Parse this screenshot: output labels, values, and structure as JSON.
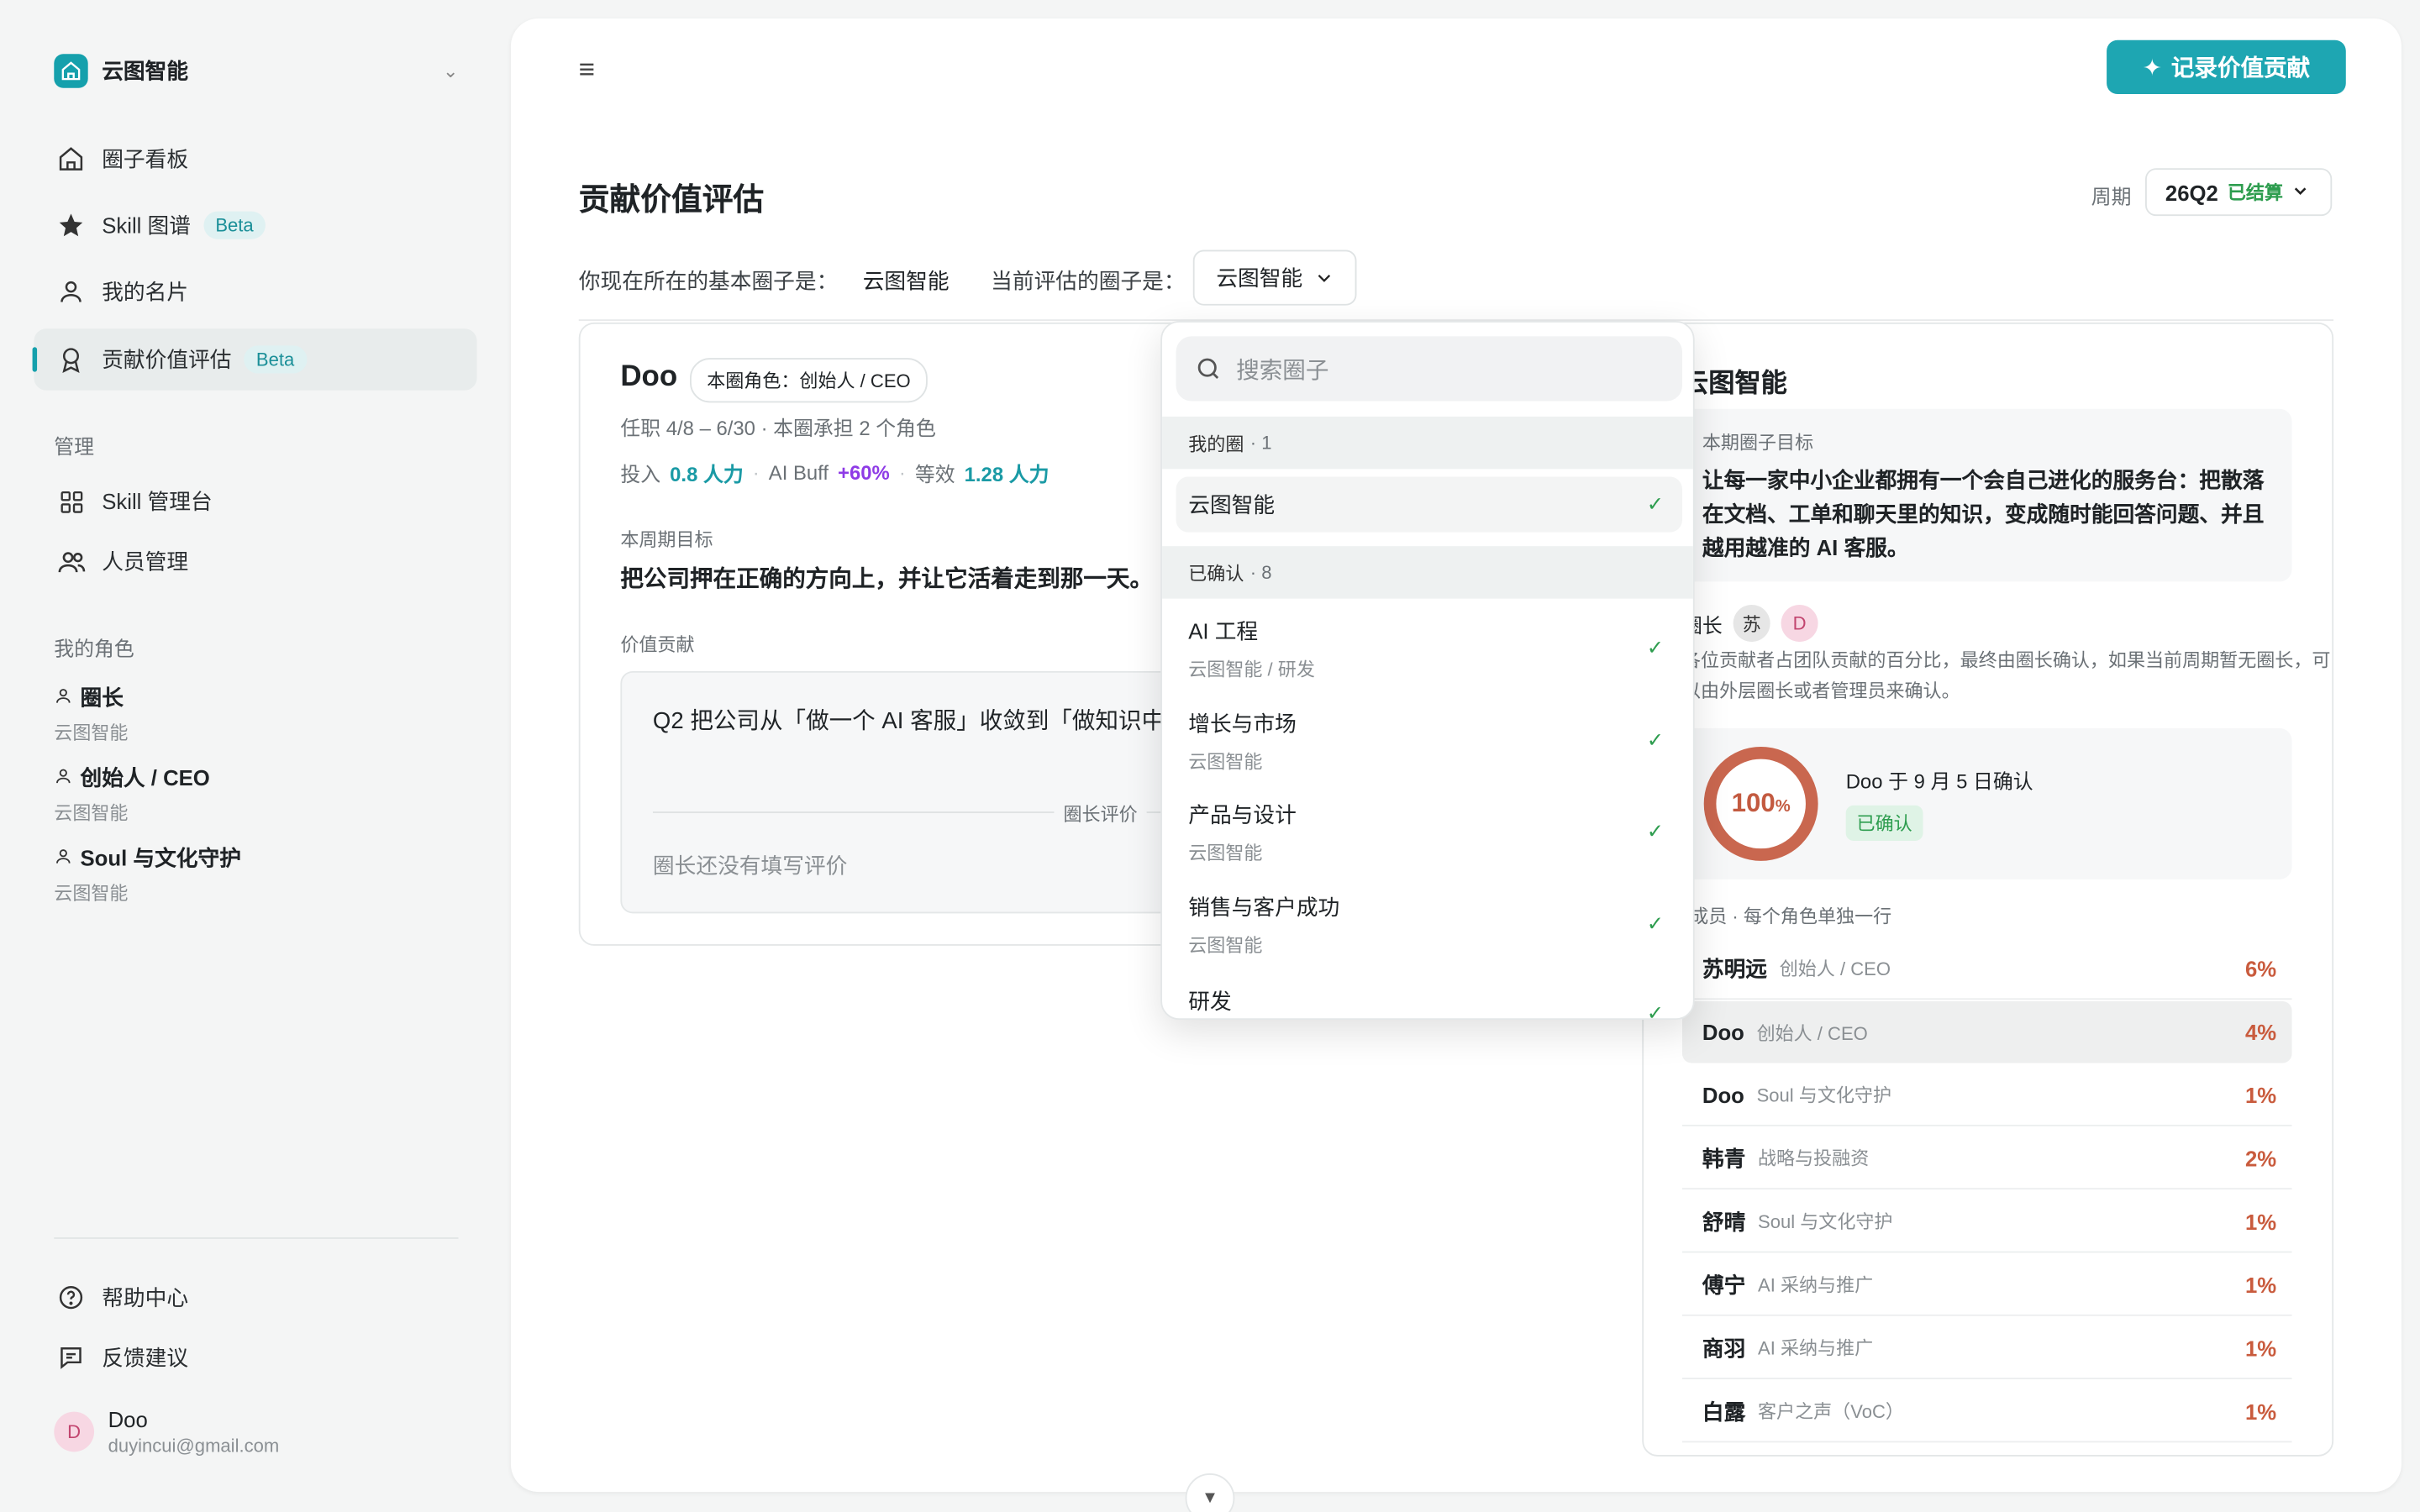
{
  "sidebar": {
    "workspace": "云图智能",
    "nav": [
      {
        "label": "圈子看板"
      },
      {
        "label": "Skill 图谱",
        "badge": "Beta"
      },
      {
        "label": "我的名片"
      },
      {
        "label": "贡献价值评估",
        "badge": "Beta"
      }
    ],
    "manage_label": "管理",
    "manage": [
      {
        "label": "Skill 管理台"
      },
      {
        "label": "人员管理"
      }
    ],
    "roles_label": "我的角色",
    "roles": [
      {
        "name": "圈长",
        "sub": "云图智能"
      },
      {
        "name": "创始人 / CEO",
        "sub": "云图智能"
      },
      {
        "name": "Soul 与文化守护",
        "sub": "云图智能"
      }
    ],
    "help": "帮助中心",
    "feedback": "反馈建议",
    "user": {
      "initial": "D",
      "name": "Doo",
      "email": "duyincui@gmail.com"
    }
  },
  "header": {
    "record_button": "记录价值贡献",
    "title": "贡献价值评估",
    "period_label": "周期",
    "period_value": "26Q2",
    "period_status": "已结算",
    "base_circle_label": "你现在所在的基本圈子是：",
    "base_circle_value": "云图智能",
    "current_circle_label": "当前评估的圈子是：",
    "current_circle_value": "云图智能"
  },
  "left": {
    "name": "Doo",
    "role_badge": "本圈角色：创始人 / CEO",
    "tenure": "任职 4/8 – 6/30 · 本圈承担 2 个角色",
    "input_label": "投入",
    "input_value": "0.8 人力",
    "buff_label": "AI Buff",
    "buff_value": "+60%",
    "eq_label": "等效",
    "eq_value": "1.28 人力",
    "goal_label": "本周期目标",
    "goal": "把公司押在正确的方向上，并让它活着走到那一天。",
    "value_label": "价值贡献",
    "value_text": "Q2 把公司从「做一个 AI 客服」收敛到「做知识中台」，团队和融资都顺了。",
    "review_label": "圈长评价",
    "review_empty": "圈长还没有填写评价"
  },
  "right": {
    "title": "云图智能",
    "goal_label": "本期圈子目标",
    "goal": "让每一家中小企业都拥有一个会自己进化的服务台：把散落在文档、工单和聊天里的知识，变成随时能回答问题、并且越用越准的 AI 客服。",
    "lead_label": "圈长",
    "lead_avatars": [
      "苏",
      "D"
    ],
    "desc": "各位贡献者占团队贡献的百分比，最终由圈长确认，如果当前周期暂无圈长，可以由外层圈长或者管理员来确认。",
    "percent": "100",
    "percent_unit": "%",
    "confirm_text": "Doo 于 9 月 5 日确认",
    "confirm_badge": "已确认",
    "members_label": "成员 · 每个角色单独一行",
    "members": [
      {
        "name": "苏明远",
        "role": "创始人 / CEO",
        "pct": "6%"
      },
      {
        "name": "Doo",
        "role": "创始人 / CEO",
        "pct": "4%"
      },
      {
        "name": "Doo",
        "role": "Soul 与文化守护",
        "pct": "1%"
      },
      {
        "name": "韩青",
        "role": "战略与投融资",
        "pct": "2%"
      },
      {
        "name": "舒晴",
        "role": "Soul 与文化守护",
        "pct": "1%"
      },
      {
        "name": "傅宁",
        "role": "AI 采纳与推广",
        "pct": "1%"
      },
      {
        "name": "商羽",
        "role": "AI 采纳与推广",
        "pct": "1%"
      },
      {
        "name": "白露",
        "role": "客户之声（VoC）",
        "pct": "1%"
      }
    ]
  },
  "dropdown": {
    "search_placeholder": "搜索圈子",
    "my_group": "我的圈",
    "my_count": "· 1",
    "my_items": [
      {
        "name": "云图智能"
      }
    ],
    "confirmed_group": "已确认",
    "confirmed_count": "· 8",
    "confirmed_items": [
      {
        "name": "AI 工程",
        "sub": "云图智能 / 研发"
      },
      {
        "name": "增长与市场",
        "sub": "云图智能"
      },
      {
        "name": "产品与设计",
        "sub": "云图智能"
      },
      {
        "name": "销售与客户成功",
        "sub": "云图智能"
      },
      {
        "name": "研发",
        "sub": ""
      }
    ]
  },
  "colors": {
    "accent": "#1ea6b2",
    "active_bg": "#e8ecec",
    "percent": "#c95b3d",
    "confirmed": "#2e9d4f",
    "buff": "#8e3be6"
  }
}
